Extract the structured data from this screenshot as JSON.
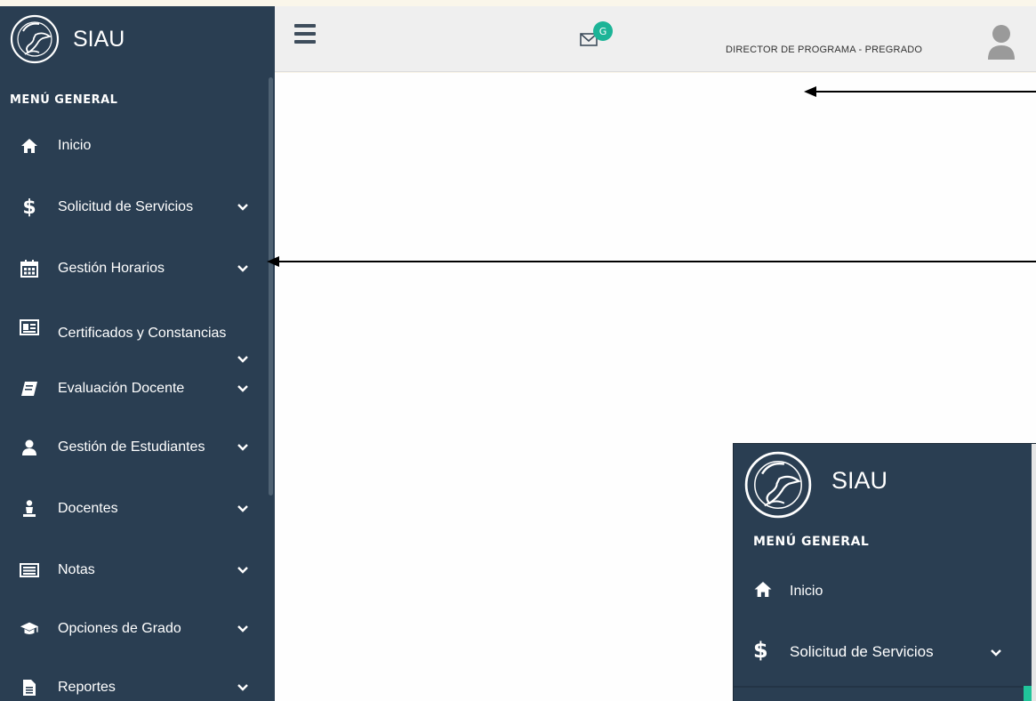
{
  "app": {
    "title": "SIAU"
  },
  "sidebar": {
    "header": "MENÚ GENERAL",
    "items": [
      {
        "label": "Inicio",
        "icon": "home-icon",
        "has_submenu": false
      },
      {
        "label": "Solicitud de Servicios",
        "icon": "dollar-icon",
        "has_submenu": true
      },
      {
        "label": "Gestión Horarios",
        "icon": "calendar-icon",
        "has_submenu": true
      },
      {
        "label": "Certificados y Constancias",
        "icon": "id-card-icon",
        "has_submenu": true
      },
      {
        "label": "Evaluación Docente",
        "icon": "book-icon",
        "has_submenu": true
      },
      {
        "label": "Gestión de Estudiantes",
        "icon": "user-icon",
        "has_submenu": true
      },
      {
        "label": "Docentes",
        "icon": "teacher-icon",
        "has_submenu": true
      },
      {
        "label": "Notas",
        "icon": "list-icon",
        "has_submenu": true
      },
      {
        "label": "Opciones de Grado",
        "icon": "graduation-cap-icon",
        "has_submenu": true
      },
      {
        "label": "Reportes",
        "icon": "file-icon",
        "has_submenu": true
      }
    ]
  },
  "topbar": {
    "notification_badge": "G",
    "user_role": "DIRECTOR DE PROGRAMA - PREGRADO"
  },
  "inset": {
    "title": "SIAU",
    "header": "MENÚ GENERAL",
    "items": [
      {
        "label": "Inicio",
        "icon": "home-icon"
      },
      {
        "label": "Solicitud de Servicios",
        "icon": "dollar-icon"
      }
    ]
  },
  "colors": {
    "sidebar_bg": "#2a3e52",
    "topbar_bg": "#efefef",
    "badge": "#1cb497",
    "accent": "#20c49a"
  }
}
